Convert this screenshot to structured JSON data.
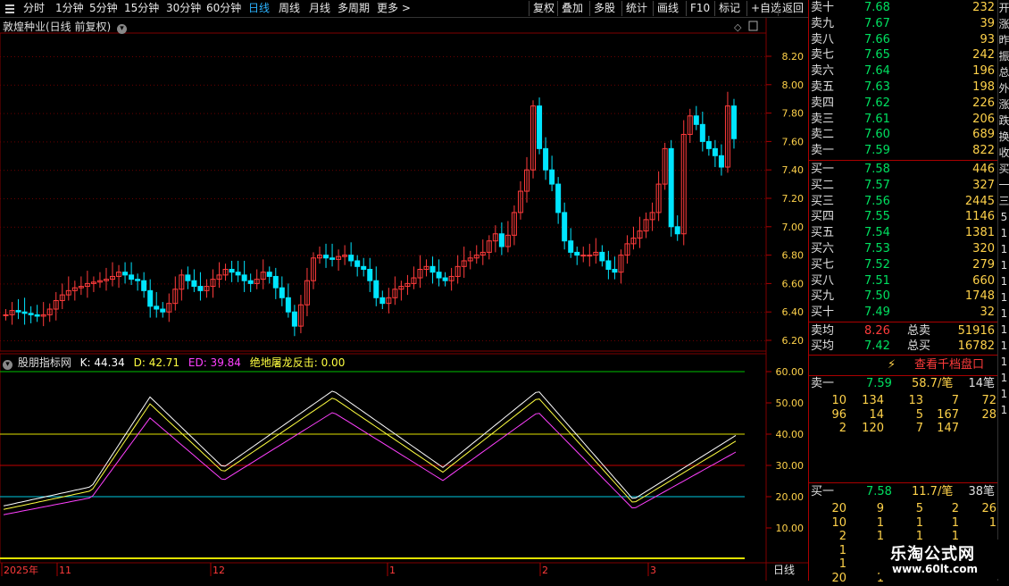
{
  "toolbar": {
    "left_items": [
      "分时",
      "1分钟",
      "5分钟",
      "15分钟",
      "30分钟",
      "60分钟",
      "日线",
      "周线",
      "月线",
      "多周期",
      "更多 >"
    ],
    "active": "日线",
    "right_items": [
      "复权",
      "叠加",
      "多股",
      "统计",
      "画线",
      "F10",
      "标记",
      "+自选",
      "返回"
    ]
  },
  "stock_title": "敦煌种业(日线 前复权)",
  "price_axis": [
    "8.20",
    "8.00",
    "7.80",
    "7.60",
    "7.40",
    "7.20",
    "7.00",
    "6.80",
    "6.60",
    "6.40",
    "6.20"
  ],
  "indicator": {
    "name": "股朋指标网",
    "k": "K: 44.34",
    "d": "D: 42.71",
    "ed": "ED: 39.84",
    "signal": "绝地屠龙反击: 0.00",
    "axis": [
      "60.00",
      "50.00",
      "40.00",
      "30.00",
      "20.00",
      "10.00"
    ]
  },
  "date_axis": [
    "2025年",
    "11",
    "12",
    "1",
    "2",
    "3"
  ],
  "period_label": "日线",
  "colors": {
    "up": "#ff3b3b",
    "down": "#00e5ff",
    "k": "#ffffff",
    "d": "#ffff40",
    "ed": "#ff40ff"
  },
  "order_book": {
    "sells": [
      {
        "label": "卖十",
        "price": "7.68",
        "vol": "232"
      },
      {
        "label": "卖九",
        "price": "7.67",
        "vol": "39"
      },
      {
        "label": "卖八",
        "price": "7.66",
        "vol": "93"
      },
      {
        "label": "卖七",
        "price": "7.65",
        "vol": "242"
      },
      {
        "label": "卖六",
        "price": "7.64",
        "vol": "196"
      },
      {
        "label": "卖五",
        "price": "7.63",
        "vol": "198"
      },
      {
        "label": "卖四",
        "price": "7.62",
        "vol": "226"
      },
      {
        "label": "卖三",
        "price": "7.61",
        "vol": "206"
      },
      {
        "label": "卖二",
        "price": "7.60",
        "vol": "689"
      },
      {
        "label": "卖一",
        "price": "7.59",
        "vol": "822"
      }
    ],
    "buys": [
      {
        "label": "买一",
        "price": "7.58",
        "vol": "446"
      },
      {
        "label": "买二",
        "price": "7.57",
        "vol": "327"
      },
      {
        "label": "买三",
        "price": "7.56",
        "vol": "2445"
      },
      {
        "label": "买四",
        "price": "7.55",
        "vol": "1146"
      },
      {
        "label": "买五",
        "price": "7.54",
        "vol": "1381"
      },
      {
        "label": "买六",
        "price": "7.53",
        "vol": "320"
      },
      {
        "label": "买七",
        "price": "7.52",
        "vol": "279"
      },
      {
        "label": "买八",
        "price": "7.51",
        "vol": "660"
      },
      {
        "label": "买九",
        "price": "7.50",
        "vol": "1748"
      },
      {
        "label": "买十",
        "price": "7.49",
        "vol": "32"
      }
    ],
    "avg_sell": {
      "label": "卖均",
      "price": "8.26",
      "tlabel": "总卖",
      "vol": "51916"
    },
    "avg_buy": {
      "label": "买均",
      "price": "7.42",
      "tlabel": "总买",
      "vol": "16782"
    },
    "depth_button": "查看千档盘口",
    "sell_one_detail": {
      "label": "卖一",
      "price": "7.59",
      "avg": "58.7/笔",
      "count": "14笔"
    },
    "sell_queue": [
      [
        "10",
        "134",
        "13",
        "7",
        "72"
      ],
      [
        "96",
        "14",
        "5",
        "167",
        "28"
      ],
      [
        "2",
        "120",
        "7",
        "147",
        ""
      ]
    ],
    "buy_one_detail": {
      "label": "买一",
      "price": "7.58",
      "avg": "11.7/笔",
      "count": "38笔"
    },
    "buy_queue": [
      [
        "20",
        "9",
        "5",
        "2",
        "26"
      ],
      [
        "10",
        "1",
        "1",
        "1",
        "1"
      ],
      [
        "2",
        "1",
        "1",
        "1",
        ""
      ],
      [
        "1",
        "",
        "",
        "",
        ""
      ],
      [
        "1",
        "",
        "",
        "",
        ""
      ],
      [
        "20",
        "1",
        "",
        "",
        ""
      ]
    ]
  },
  "right_strip": [
    "开",
    "涨",
    "昨",
    "振",
    "总",
    "外",
    "涨",
    "跌",
    "换",
    "收",
    "买",
    "一",
    "三",
    "5",
    "1",
    "1",
    "1",
    "1",
    "1",
    "1",
    "1",
    "1",
    "1",
    "1",
    "1",
    "1"
  ],
  "watermark": {
    "line1": "乐淘公式网",
    "line2": "www.60lt.com"
  }
}
